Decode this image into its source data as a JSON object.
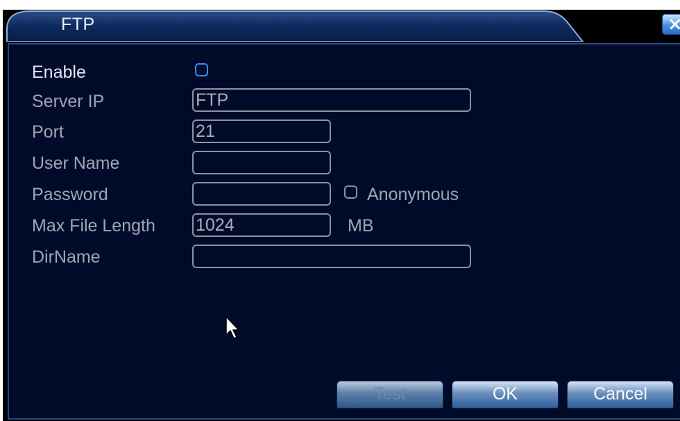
{
  "window": {
    "title": "FTP",
    "close_label": "×"
  },
  "form": {
    "enable_label": "Enable",
    "enable_checked": true,
    "server_ip_label": "Server IP",
    "server_ip_value": "FTP",
    "port_label": "Port",
    "port_value": "21",
    "user_name_label": "User Name",
    "user_name_value": "",
    "password_label": "Password",
    "password_value": "",
    "anonymous_label": "Anonymous",
    "anonymous_checked": false,
    "max_file_length_label": "Max File Length",
    "max_file_length_value": "1024",
    "max_file_length_unit": "MB",
    "dirname_label": "DirName",
    "dirname_value": ""
  },
  "buttons": {
    "test": "Test",
    "ok": "OK",
    "cancel": "Cancel"
  },
  "colors": {
    "panel_bg": "#000b2a",
    "title_tab": "#0d2a5c",
    "accent": "#3d8ff0",
    "label_text": "#9fa6b4"
  }
}
